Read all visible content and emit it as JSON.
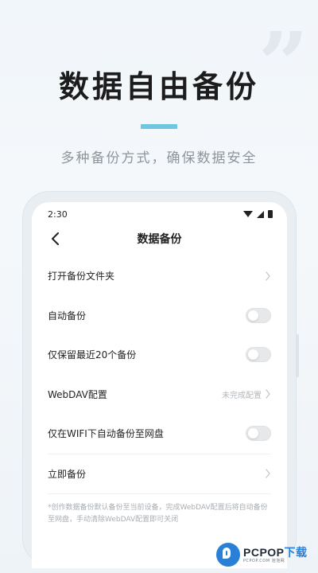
{
  "promo": {
    "headline": "数据自由备份",
    "subtitle": "多种备份方式，确保数据安全",
    "accent_color": "#6ec6e0",
    "decoration_icon": "quote-mark-icon"
  },
  "status_bar": {
    "time": "2:30",
    "icons": [
      "wifi-icon",
      "signal-icon",
      "battery-icon"
    ]
  },
  "nav": {
    "back_icon": "chevron-left-icon",
    "title": "数据备份"
  },
  "settings": {
    "open_folder": {
      "label": "打开备份文件夹",
      "type": "link"
    },
    "auto_backup": {
      "label": "自动备份",
      "type": "toggle",
      "on": false
    },
    "keep_recent": {
      "label": "仅保留最近20个备份",
      "type": "toggle",
      "on": false
    },
    "webdav": {
      "label": "WebDAV配置",
      "value": "未完成配置",
      "type": "link"
    },
    "wifi_only": {
      "label": "仅在WIFI下自动备份至网盘",
      "type": "toggle",
      "on": false
    },
    "backup_now": {
      "label": "立即备份",
      "type": "link"
    }
  },
  "footnote": "*创作数据备份默认备份至当前设备，完成WebDAV配置后将自动备份至网盘，手动清除WebDAV配置即可关闭",
  "watermark": {
    "brand_main": "PCPOP",
    "brand_accent": "下载",
    "tagline": "PCPOP.COM 泡泡网"
  }
}
